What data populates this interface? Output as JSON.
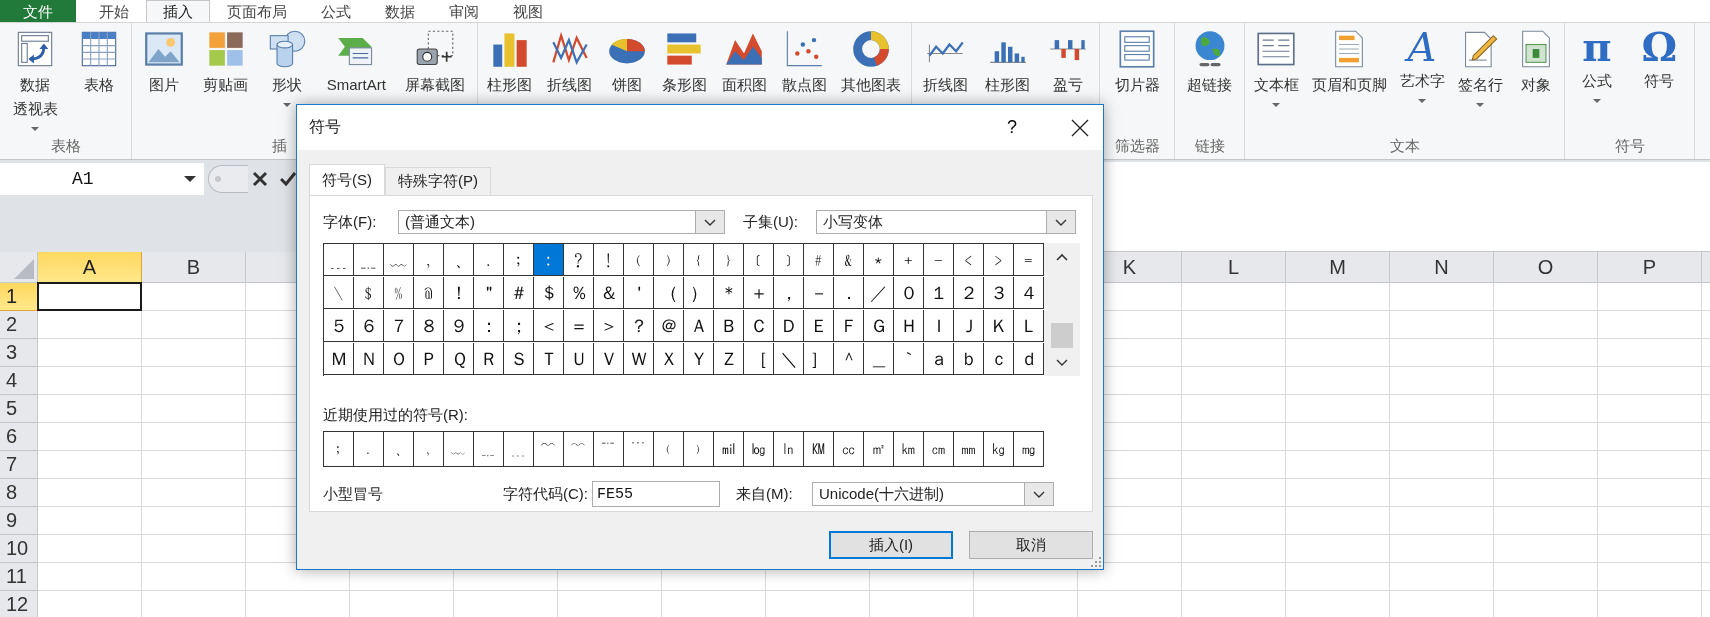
{
  "ribbon_tabs": [
    {
      "label": "文件",
      "kind": "file",
      "selected": false
    },
    {
      "label": "开始",
      "kind": "tab",
      "selected": false
    },
    {
      "label": "插入",
      "kind": "tab",
      "selected": true
    },
    {
      "label": "页面布局",
      "kind": "tab",
      "selected": false
    },
    {
      "label": "公式",
      "kind": "tab",
      "selected": false
    },
    {
      "label": "数据",
      "kind": "tab",
      "selected": false
    },
    {
      "label": "审阅",
      "kind": "tab",
      "selected": false
    },
    {
      "label": "视图",
      "kind": "tab",
      "selected": false
    }
  ],
  "ribbon_groups": [
    {
      "label": "表格",
      "buttons": [
        {
          "lines": [
            "数据",
            "透视表"
          ],
          "dropdown": true
        },
        {
          "lines": [
            "表格"
          ],
          "dropdown": false
        }
      ]
    },
    {
      "label": "插",
      "buttons": [
        {
          "lines": [
            "图片"
          ],
          "dropdown": false
        },
        {
          "lines": [
            "剪贴画"
          ],
          "dropdown": false
        },
        {
          "lines": [
            "形状"
          ],
          "dropdown": true
        },
        {
          "lines": [
            "SmartArt"
          ],
          "dropdown": false
        },
        {
          "lines": [
            "屏幕截图"
          ],
          "dropdown": false
        }
      ]
    },
    {
      "buttons": [
        {
          "lines": [
            "柱形图"
          ],
          "dropdown": false
        },
        {
          "lines": [
            "折线图"
          ],
          "dropdown": false
        },
        {
          "lines": [
            "饼图"
          ],
          "dropdown": false
        },
        {
          "lines": [
            "条形图"
          ],
          "dropdown": false
        },
        {
          "lines": [
            "面积图"
          ],
          "dropdown": false
        },
        {
          "lines": [
            "散点图"
          ],
          "dropdown": false
        },
        {
          "lines": [
            "其他图表"
          ],
          "dropdown": false
        }
      ]
    },
    {
      "buttons": [
        {
          "lines": [
            "折线图"
          ],
          "dropdown": false
        },
        {
          "lines": [
            "柱形图"
          ],
          "dropdown": false
        },
        {
          "lines": [
            "盈亏"
          ],
          "dropdown": false
        }
      ]
    },
    {
      "label": "筛选器",
      "buttons": [
        {
          "lines": [
            "切片器"
          ],
          "dropdown": false
        }
      ]
    },
    {
      "label": "链接",
      "buttons": [
        {
          "lines": [
            "超链接"
          ],
          "dropdown": false
        }
      ]
    },
    {
      "label": "文本",
      "buttons": [
        {
          "lines": [
            "文本框"
          ],
          "dropdown": true
        },
        {
          "lines": [
            "页眉和页脚"
          ],
          "dropdown": false
        },
        {
          "lines": [
            "艺术字"
          ],
          "glyph": "A",
          "dropdown": true
        },
        {
          "lines": [
            "签名行"
          ],
          "dropdown": true
        },
        {
          "lines": [
            "对象"
          ],
          "dropdown": false
        }
      ]
    },
    {
      "label": "符号",
      "buttons": [
        {
          "lines": [
            "公式"
          ],
          "glyph": "π",
          "dropdown": true
        },
        {
          "lines": [
            "符号"
          ],
          "glyph": "Ω",
          "dropdown": false
        }
      ]
    }
  ],
  "name_box": {
    "value": "A1"
  },
  "sheet": {
    "columns_left": [
      {
        "label": "A",
        "selected": true
      },
      {
        "label": "B",
        "selected": false
      }
    ],
    "columns_right": [
      {
        "label": "K",
        "selected": false
      },
      {
        "label": "L",
        "selected": false
      },
      {
        "label": "M",
        "selected": false
      },
      {
        "label": "N",
        "selected": false
      },
      {
        "label": "O",
        "selected": false
      },
      {
        "label": "P",
        "selected": false
      }
    ],
    "rows": [
      {
        "label": "1",
        "selected": true
      },
      {
        "label": "2",
        "selected": false
      },
      {
        "label": "3",
        "selected": false
      },
      {
        "label": "4",
        "selected": false
      },
      {
        "label": "5",
        "selected": false
      },
      {
        "label": "6",
        "selected": false
      },
      {
        "label": "7",
        "selected": false
      },
      {
        "label": "8",
        "selected": false
      },
      {
        "label": "9",
        "selected": false
      },
      {
        "label": "10",
        "selected": false
      },
      {
        "label": "11",
        "selected": false
      },
      {
        "label": "12",
        "selected": false
      }
    ]
  },
  "dialog": {
    "title": "符号",
    "help": "?",
    "tabs": [
      {
        "label": "符号(S)",
        "selected": true
      },
      {
        "label": "特殊字符(P)",
        "selected": false
      }
    ],
    "font": {
      "label": "字体(F):",
      "value": "(普通文本)"
    },
    "subset": {
      "label": "子集(U):",
      "value": "小写变体"
    },
    "symbols": [
      [
        {
          "c": "﹍",
          "selected": false
        },
        {
          "c": "﹎",
          "selected": false
        },
        {
          "c": "﹏",
          "selected": false
        },
        {
          "c": "﹐",
          "selected": false
        },
        {
          "c": "﹑",
          "selected": false
        },
        {
          "c": "﹒",
          "selected": false
        },
        {
          "c": "﹔",
          "selected": false
        },
        {
          "c": "﹕",
          "selected": true
        },
        {
          "c": "﹖",
          "selected": false
        },
        {
          "c": "﹗",
          "selected": false
        },
        {
          "c": "﹙",
          "selected": false
        },
        {
          "c": "﹚",
          "selected": false
        },
        {
          "c": "﹛",
          "selected": false
        },
        {
          "c": "﹜",
          "selected": false
        },
        {
          "c": "﹝",
          "selected": false
        },
        {
          "c": "﹞",
          "selected": false
        },
        {
          "c": "﹟",
          "selected": false
        },
        {
          "c": "﹠",
          "selected": false
        },
        {
          "c": "﹡",
          "selected": false
        },
        {
          "c": "﹢",
          "selected": false
        },
        {
          "c": "﹣",
          "selected": false
        },
        {
          "c": "﹤",
          "selected": false
        },
        {
          "c": "﹥",
          "selected": false
        },
        {
          "c": "﹦",
          "selected": false
        }
      ],
      [
        {
          "c": "﹨",
          "selected": false
        },
        {
          "c": "﹩",
          "selected": false
        },
        {
          "c": "﹪",
          "selected": false
        },
        {
          "c": "﹫",
          "selected": false
        },
        {
          "c": "！",
          "selected": false
        },
        {
          "c": "＂",
          "selected": false
        },
        {
          "c": "＃",
          "selected": false
        },
        {
          "c": "＄",
          "selected": false
        },
        {
          "c": "％",
          "selected": false
        },
        {
          "c": "＆",
          "selected": false
        },
        {
          "c": "＇",
          "selected": false
        },
        {
          "c": "（",
          "selected": false
        },
        {
          "c": "）",
          "selected": false
        },
        {
          "c": "＊",
          "selected": false
        },
        {
          "c": "＋",
          "selected": false
        },
        {
          "c": "，",
          "selected": false
        },
        {
          "c": "－",
          "selected": false
        },
        {
          "c": "．",
          "selected": false
        },
        {
          "c": "／",
          "selected": false
        },
        {
          "c": "０",
          "selected": false
        },
        {
          "c": "１",
          "selected": false
        },
        {
          "c": "２",
          "selected": false
        },
        {
          "c": "３",
          "selected": false
        },
        {
          "c": "４",
          "selected": false
        }
      ],
      [
        {
          "c": "５",
          "selected": false
        },
        {
          "c": "６",
          "selected": false
        },
        {
          "c": "７",
          "selected": false
        },
        {
          "c": "８",
          "selected": false
        },
        {
          "c": "９",
          "selected": false
        },
        {
          "c": "：",
          "selected": false
        },
        {
          "c": "；",
          "selected": false
        },
        {
          "c": "＜",
          "selected": false
        },
        {
          "c": "＝",
          "selected": false
        },
        {
          "c": "＞",
          "selected": false
        },
        {
          "c": "？",
          "selected": false
        },
        {
          "c": "＠",
          "selected": false
        },
        {
          "c": "Ａ",
          "selected": false
        },
        {
          "c": "Ｂ",
          "selected": false
        },
        {
          "c": "Ｃ",
          "selected": false
        },
        {
          "c": "Ｄ",
          "selected": false
        },
        {
          "c": "Ｅ",
          "selected": false
        },
        {
          "c": "Ｆ",
          "selected": false
        },
        {
          "c": "Ｇ",
          "selected": false
        },
        {
          "c": "Ｈ",
          "selected": false
        },
        {
          "c": "Ｉ",
          "selected": false
        },
        {
          "c": "Ｊ",
          "selected": false
        },
        {
          "c": "Ｋ",
          "selected": false
        },
        {
          "c": "Ｌ",
          "selected": false
        }
      ],
      [
        {
          "c": "Ｍ",
          "selected": false
        },
        {
          "c": "Ｎ",
          "selected": false
        },
        {
          "c": "Ｏ",
          "selected": false
        },
        {
          "c": "Ｐ",
          "selected": false
        },
        {
          "c": "Ｑ",
          "selected": false
        },
        {
          "c": "Ｒ",
          "selected": false
        },
        {
          "c": "Ｓ",
          "selected": false
        },
        {
          "c": "Ｔ",
          "selected": false
        },
        {
          "c": "Ｕ",
          "selected": false
        },
        {
          "c": "Ｖ",
          "selected": false
        },
        {
          "c": "Ｗ",
          "selected": false
        },
        {
          "c": "Ｘ",
          "selected": false
        },
        {
          "c": "Ｙ",
          "selected": false
        },
        {
          "c": "Ｚ",
          "selected": false
        },
        {
          "c": "［",
          "selected": false
        },
        {
          "c": "＼",
          "selected": false
        },
        {
          "c": "］",
          "selected": false
        },
        {
          "c": "＾",
          "selected": false
        },
        {
          "c": "＿",
          "selected": false
        },
        {
          "c": "｀",
          "selected": false
        },
        {
          "c": "ａ",
          "selected": false
        },
        {
          "c": "ｂ",
          "selected": false
        },
        {
          "c": "ｃ",
          "selected": false
        },
        {
          "c": "ｄ",
          "selected": false
        }
      ]
    ],
    "recent_label": "近期使用过的符号(R):",
    "recent": [
      "﹔",
      "﹒",
      "﹑",
      "﹐",
      "﹏",
      "﹎",
      "﹍",
      "﹌",
      "﹋",
      "﹊",
      "﹉",
      "﹙",
      "﹚",
      "㏕",
      "㏒",
      "㏑",
      "㏎",
      "㏄",
      "㎡",
      "㎞",
      "㎝",
      "㎜",
      "㎏",
      "㎎"
    ],
    "char_name": "小型冒号",
    "char_code": {
      "label": "字符代码(C):",
      "value": "FE55"
    },
    "from": {
      "label": "来自(M):",
      "value": "Unicode(十六进制)"
    },
    "buttons": [
      {
        "label": "插入(I)",
        "default": true
      },
      {
        "label": "取消",
        "default": false
      }
    ]
  }
}
